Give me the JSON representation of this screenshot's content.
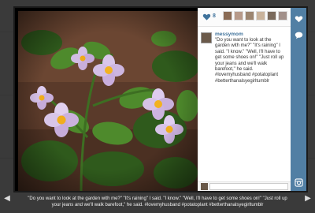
{
  "panel": {
    "like_count": "8",
    "username": "messymom",
    "caption": "\"Do you want to look at the garden with me?\" \"It's raining\" I said. \"I know.\" \"Well, I'll have to get some shoes on!\" \"Just roll up your jeans and we'll walk barefoot,\" he said. #lovemyhusband #potatoplant #betterthanalsyegirltumblr"
  },
  "lightbox": {
    "bottom_caption": "\"Do you want to look at the garden with me?\" \"It's raining\" I said. \"I know.\" \"Well, I'll have to get some shoes on!\" \"Just roll up your jeans and we'll walk barefoot,\" he said. #lovemyhusband #potatoplant #betterthanalsyegirltumblr",
    "prev_symbol": "◀",
    "next_symbol": "▶"
  },
  "colors": {
    "accent": "#517fa4",
    "link": "#3f729b"
  },
  "icons": [
    "heart-icon",
    "speech-bubble-icon",
    "instagram-icon",
    "left-arrow-icon",
    "right-arrow-icon"
  ]
}
